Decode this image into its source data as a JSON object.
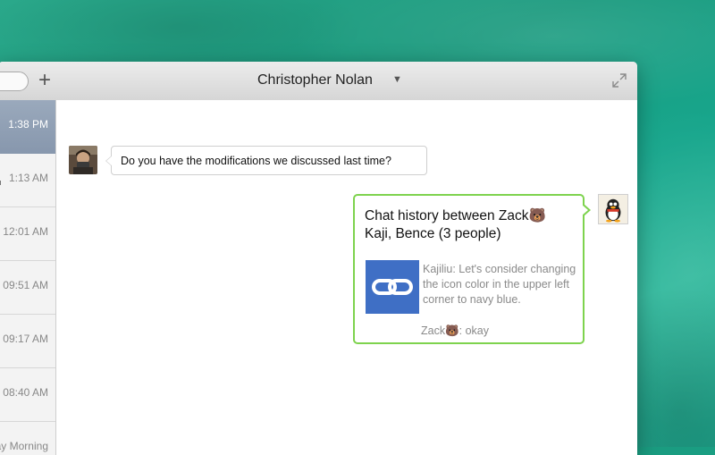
{
  "window": {
    "title": "Christopher Nolan",
    "title_dropdown_icon": "triangle-down-icon",
    "add_icon": "plus-icon",
    "expand_icon": "expand-icon"
  },
  "sidebar": {
    "sessions": [
      {
        "time": "1:38 PM",
        "active": true
      },
      {
        "time": "1:13 AM"
      },
      {
        "time": "12:01 AM"
      },
      {
        "time": "09:51 AM"
      },
      {
        "time": "09:17 AM"
      },
      {
        "time": "08:40 AM"
      },
      {
        "time": "ay Morning"
      }
    ]
  },
  "messages": {
    "incoming": {
      "text": "Do you have the modifications we discussed last time?",
      "avatar": "user-photo-avatar"
    },
    "outgoing": {
      "avatar": "penguin-mascot-avatar",
      "history_title": "Chat history between Zack🐻 Kaji, Bence (3 people)",
      "link_icon": "chain-link-icon",
      "preview_text": "Kajiliu:  Let's consider changing the icon color in the upper left corner to navy blue.",
      "reply_name": "Zack🐻",
      "reply_text": ": okay"
    }
  },
  "colors": {
    "active_session": "#8f9fb4",
    "outgoing_border": "#7ed34e",
    "link_thumb": "#3f6fc5",
    "wallpaper": "#1b9a7e"
  }
}
